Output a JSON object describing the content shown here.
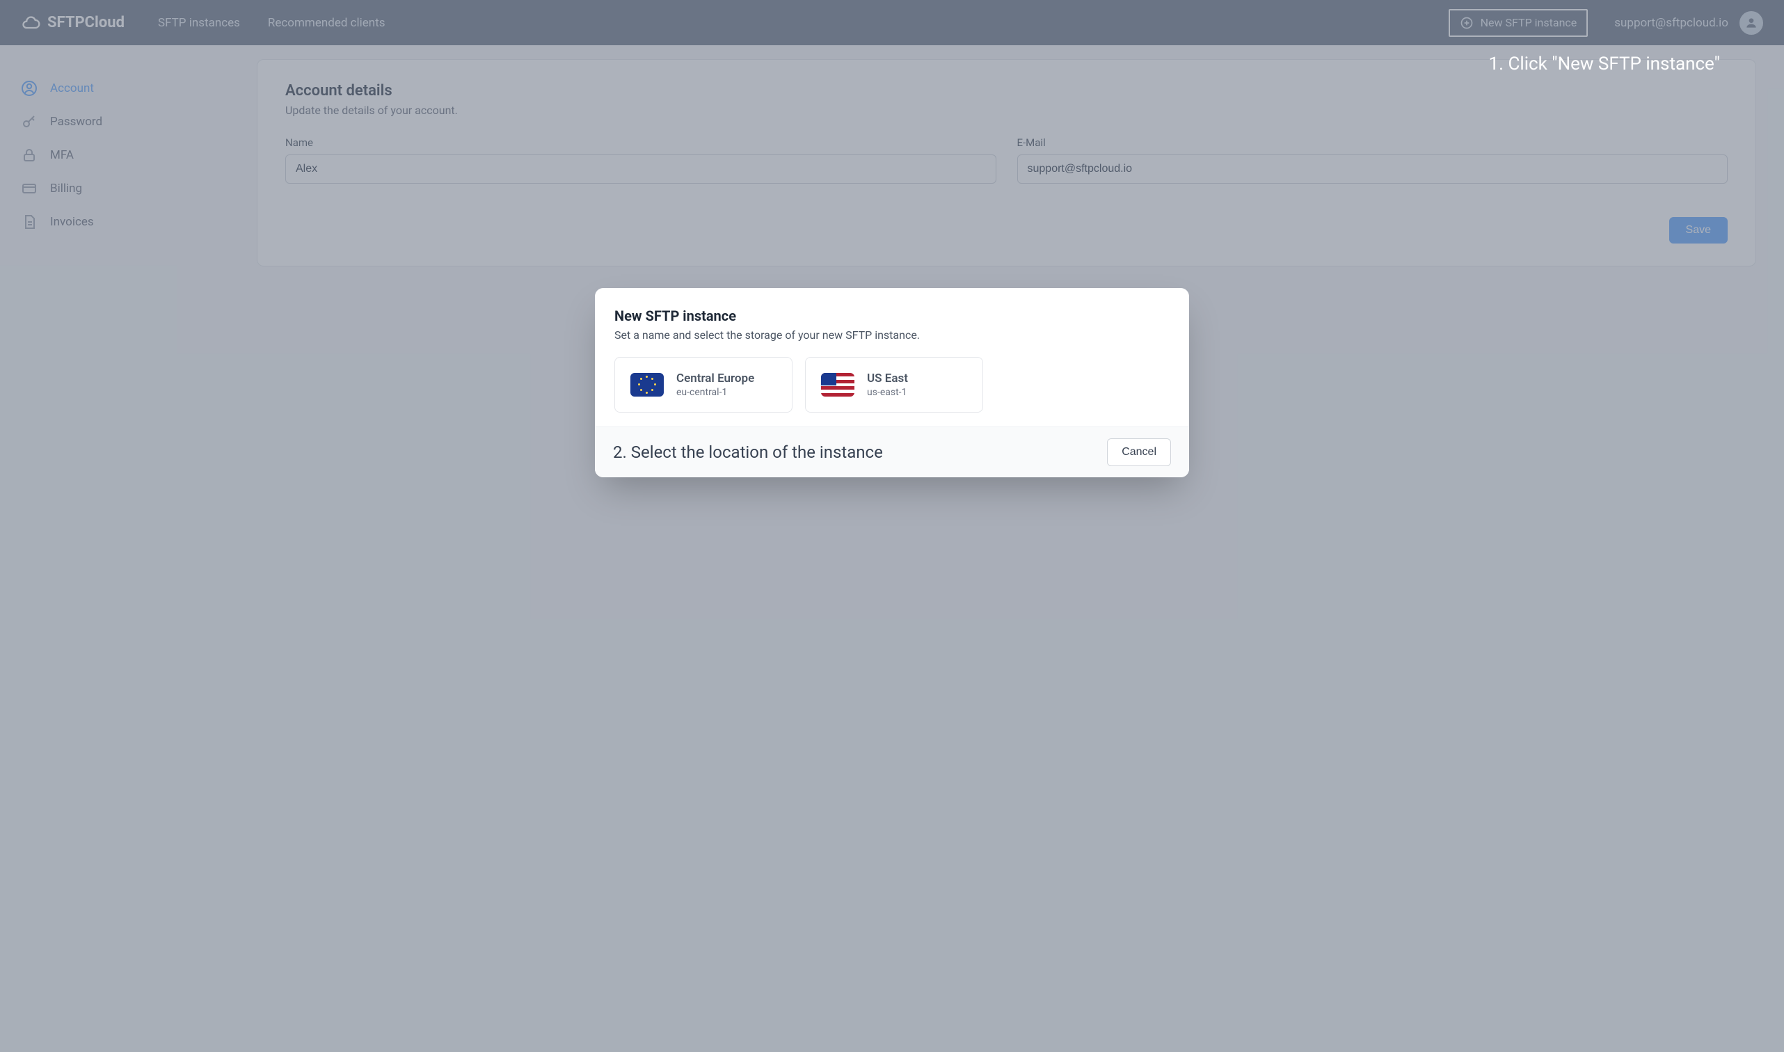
{
  "brand": "SFTPCloud",
  "nav": {
    "instances": "SFTP instances",
    "clients": "Recommended clients"
  },
  "new_instance_button": "New SFTP instance",
  "support_email": "support@sftpcloud.io",
  "callouts": {
    "step1": "1. Click \"New SFTP instance\"",
    "step2": "2. Select the location of the instance"
  },
  "sidebar": {
    "items": [
      {
        "label": "Account"
      },
      {
        "label": "Password"
      },
      {
        "label": "MFA"
      },
      {
        "label": "Billing"
      },
      {
        "label": "Invoices"
      }
    ]
  },
  "account_details": {
    "title": "Account details",
    "subtitle": "Update the details of your account.",
    "name_label": "Name",
    "name_value": "Alex",
    "email_label": "E-Mail",
    "email_value": "support@sftpcloud.io",
    "save": "Save"
  },
  "modal": {
    "title": "New SFTP instance",
    "subtitle": "Set a name and select the storage of your new SFTP instance.",
    "regions": [
      {
        "name": "Central Europe",
        "code": "eu-central-1"
      },
      {
        "name": "US East",
        "code": "us-east-1"
      }
    ],
    "cancel": "Cancel"
  }
}
